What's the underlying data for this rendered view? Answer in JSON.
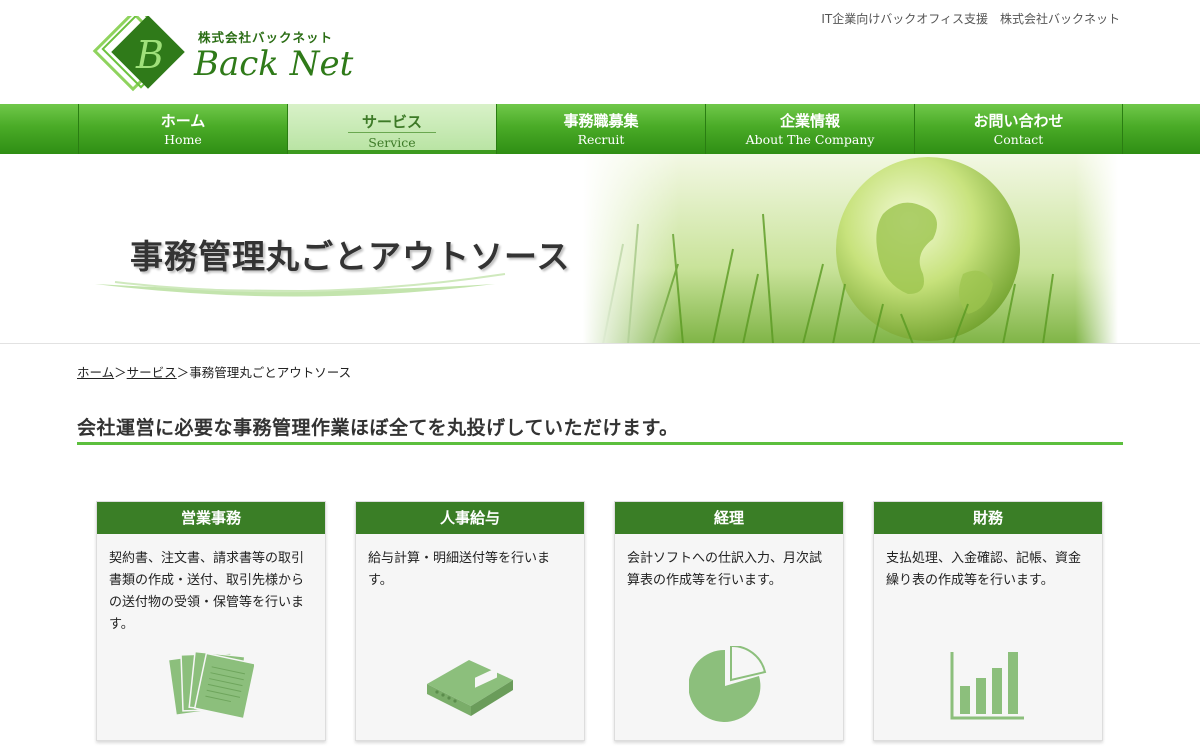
{
  "header": {
    "company_small": "株式会社バックネット",
    "logo_name": "Back Net",
    "tagline": "IT企業向けバックオフィス支援　株式会社バックネット"
  },
  "nav": [
    {
      "jp": "ホーム",
      "en": "Home"
    },
    {
      "jp": "サービス",
      "en": "Service"
    },
    {
      "jp": "事務職募集",
      "en": "Recruit"
    },
    {
      "jp": "企業情報",
      "en": "About The Company"
    },
    {
      "jp": "お問い合わせ",
      "en": "Contact"
    }
  ],
  "hero": {
    "title": "事務管理丸ごとアウトソース"
  },
  "breadcrumb": {
    "home": "ホーム",
    "sep": "＞",
    "service": "サービス",
    "current": "事務管理丸ごとアウトソース"
  },
  "lead": {
    "text": "会社運営に必要な事務管理作業ほぼ全てを丸投げしていただけます。"
  },
  "cards": [
    {
      "title": "営業事務",
      "body": "契約書、注文書、請求書等の取引書類の作成・送付、取引先様からの送付物の受領・保管等を行います。",
      "icon": "documents-icon"
    },
    {
      "title": "人事給与",
      "body": "給与計算・明細送付等を行います。",
      "icon": "binder-icon"
    },
    {
      "title": "経理",
      "body": "会計ソフトへの仕訳入力、月次試算表の作成等を行います。",
      "icon": "pie-chart-icon"
    },
    {
      "title": "財務",
      "body": "支払処理、入金確認、記帳、資金繰り表の作成等を行います。",
      "icon": "bar-chart-icon"
    }
  ],
  "colors": {
    "brand_green": "#3a7e26",
    "nav_green": "#4aab27",
    "accent_line": "#5cbf3d",
    "icon_green": "#8cbf7c"
  }
}
